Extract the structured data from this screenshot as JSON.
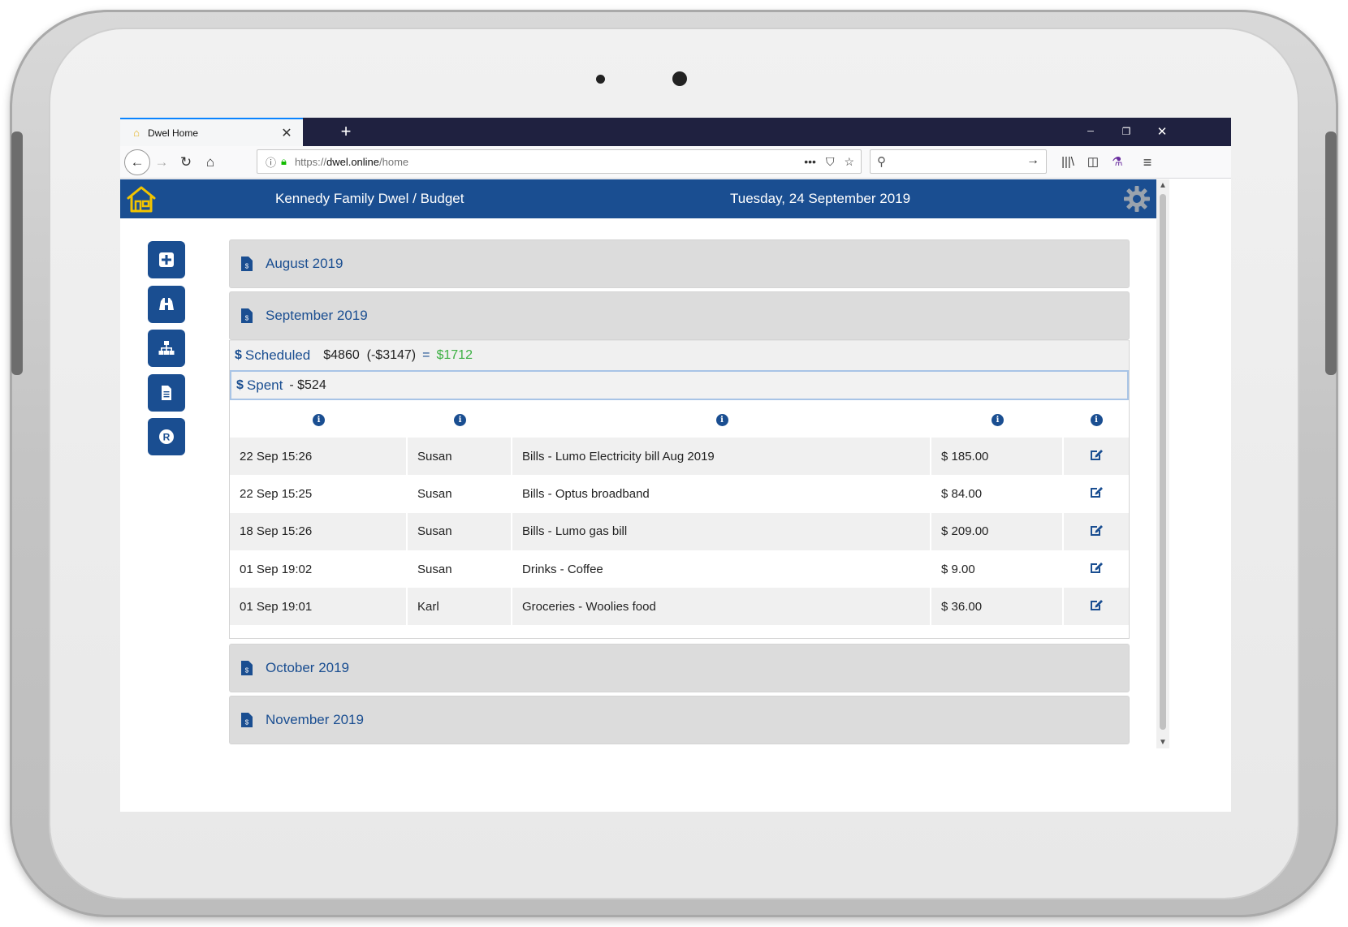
{
  "browser": {
    "tab_title": "Dwel Home",
    "tab_close": "✕",
    "new_tab": "+",
    "url_scheme": "https://",
    "url_host": "dwel.online",
    "url_path": "/home",
    "window_controls": {
      "minimize": "─",
      "restore": "❐",
      "close": "✕"
    }
  },
  "header": {
    "title": "Kennedy Family Dwel / Budget",
    "date": "Tuesday, 24 September 2019"
  },
  "sidenav": {
    "items": [
      {
        "name": "add",
        "icon": "plus-square-icon"
      },
      {
        "name": "search",
        "icon": "binoculars-icon"
      },
      {
        "name": "hierarchy",
        "icon": "sitemap-icon"
      },
      {
        "name": "document",
        "icon": "file-text-icon"
      },
      {
        "name": "r-badge",
        "icon": "r-circle-icon"
      }
    ]
  },
  "months": {
    "august": "August 2019",
    "september": "September 2019",
    "october": "October 2019",
    "november": "November 2019"
  },
  "september": {
    "scheduled_label": "Scheduled",
    "scheduled_amount": "$4860",
    "scheduled_spent": "(-$3147)",
    "equals": "=",
    "scheduled_remaining": "$1712",
    "spent_label": "Spent",
    "spent_amount": "- $524",
    "transactions": [
      {
        "date": "22 Sep 15:26",
        "person": "Susan",
        "description": "Bills - Lumo Electricity bill Aug 2019",
        "amount": "$ 185.00"
      },
      {
        "date": "22 Sep 15:25",
        "person": "Susan",
        "description": "Bills - Optus broadband",
        "amount": "$ 84.00"
      },
      {
        "date": "18 Sep 15:26",
        "person": "Susan",
        "description": "Bills - Lumo gas bill",
        "amount": "$ 209.00"
      },
      {
        "date": "01 Sep 19:02",
        "person": "Susan",
        "description": "Drinks - Coffee",
        "amount": "$ 9.00"
      },
      {
        "date": "01 Sep 19:01",
        "person": "Karl",
        "description": "Groceries - Woolies food",
        "amount": "$ 36.00"
      }
    ]
  },
  "colors": {
    "brand": "#1a4e91",
    "positive": "#3cb043",
    "tab_strip": "#1f2140",
    "logo": "#f2c400"
  }
}
